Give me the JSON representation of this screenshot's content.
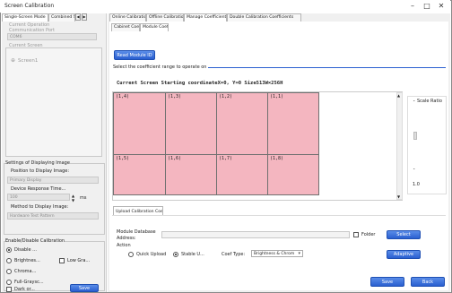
{
  "window": {
    "title": "Screen Calibration",
    "controls": {
      "minimize": "–",
      "maximize": "□",
      "close": "✕"
    }
  },
  "left": {
    "tabs": [
      "Single-Screen Mode",
      "Combined Sc"
    ],
    "current_operation": "Current Operation",
    "comm_port": "Communication Port",
    "port_value": "COM6",
    "current_screen": "Current Screen",
    "screen_item": "Screen1",
    "display_group": "Settings of Displaying Image",
    "position_label": "Position to Display Image:",
    "position_value": "Primary Display",
    "response_label": "Device Response Time...",
    "response_value": "100",
    "response_unit": "ms",
    "method_label": "Method to Display Image:",
    "method_value": "Hardware Test Pattern",
    "enable_group": "Enable/Disable Calibration",
    "opt_disable": "Disable ...",
    "opt_brightness": "Brightnes...",
    "opt_lowgray": "Low Gra...",
    "opt_chroma": "Chroma...",
    "opt_fullgray": "Full-Graysc...",
    "opt_dark": "Dark or...",
    "save_btn": "Save"
  },
  "main": {
    "tabs": [
      "Online Calibration",
      "Offline Calibration",
      "Manage Coefficients",
      "Double Calibration Coefficients"
    ],
    "subtabs": [
      "Cabinet Coef",
      "Module Coef"
    ],
    "read_btn": "Read Module ID",
    "range_label": "Select the coefficient range to operate on",
    "info_text": "Current Screen  Starting coordinateX=0, Y=0  Size513W×256H",
    "cells": [
      "(1,4)",
      "(1,3)",
      "(1,2)",
      "(1,1)",
      "(1,5)",
      "(1,6)",
      "(1,7)",
      "(1,8)"
    ],
    "scale_label": "Scale Ratio",
    "scale_value": "1.0",
    "upload_tab": "Upload Calibration Coef",
    "db_label": "Module Database",
    "db_label2": "Address:",
    "folder_label": "Folder",
    "select_btn": "Select",
    "action_label": "Action",
    "quick_upload": "Quick Upload",
    "stable_upload": "Stable U...",
    "coef_type_label": "Coef Type:",
    "coef_type_value": "Brightness & Chrom",
    "adaptive_btn": "Adaptive",
    "save_btn": "Save",
    "back_btn": "Back"
  },
  "colors": {
    "accent": "#2a5fd0",
    "cell": "#f4b6c0",
    "rule": "#2a5fd0"
  }
}
